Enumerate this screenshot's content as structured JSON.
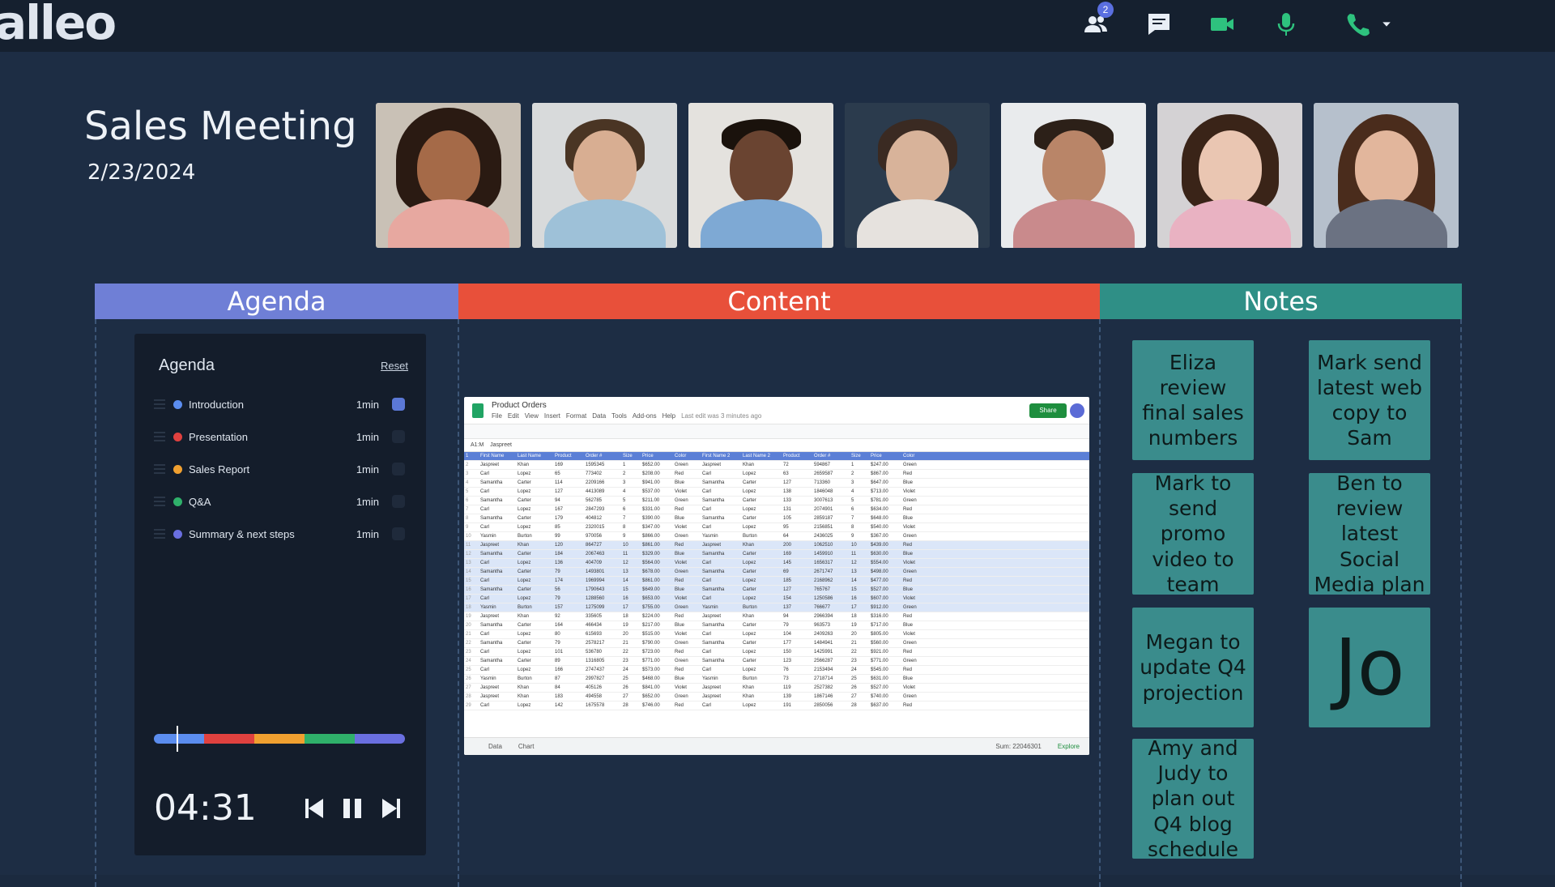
{
  "app": {
    "logo": "alleo"
  },
  "toolbar": {
    "participants_badge": "2",
    "icons": [
      "people-icon",
      "chat-icon",
      "video-camera-icon",
      "microphone-icon",
      "phone-icon",
      "chevron-down-icon"
    ],
    "colors": {
      "video": "#2ec27e",
      "mic": "#2ec27e",
      "phone": "#2ec27e"
    }
  },
  "meeting": {
    "title": "Sales Meeting",
    "date": "2/23/2024"
  },
  "participants_count": 7,
  "sections": {
    "agenda": "Agenda",
    "content": "Content",
    "notes": "Notes"
  },
  "section_colors": {
    "agenda": "#6f7fd6",
    "content": "#e8503a",
    "notes": "#2f8f86"
  },
  "agenda": {
    "title": "Agenda",
    "reset_label": "Reset",
    "items": [
      {
        "label": "Introduction",
        "time": "1min",
        "color": "#5b8def",
        "checked": true
      },
      {
        "label": "Presentation",
        "time": "1min",
        "color": "#e0413f",
        "checked": false
      },
      {
        "label": "Sales Report",
        "time": "1min",
        "color": "#f0a030",
        "checked": false
      },
      {
        "label": "Q&A",
        "time": "1min",
        "color": "#2fb06a",
        "checked": false
      },
      {
        "label": "Summary & next steps",
        "time": "1min",
        "color": "#6a6fe0",
        "checked": false
      }
    ],
    "timer": "04:31",
    "progress_colors": [
      "#5b8def",
      "#e0413f",
      "#f0a030",
      "#2fb06a",
      "#6a6fe0"
    ]
  },
  "spreadsheet": {
    "title": "Product Orders",
    "menu": [
      "File",
      "Edit",
      "View",
      "Insert",
      "Format",
      "Data",
      "Tools",
      "Add-ons",
      "Help"
    ],
    "last_edit": "Last edit was 3 minutes ago",
    "share_label": "Share",
    "cell_ref": "A1:M",
    "formula": "Jaspreet",
    "headers": [
      "First Name",
      "Last Name",
      "Product",
      "Order #",
      "Size",
      "Price",
      "Color",
      "First Name 2",
      "Last Name 2",
      "Product",
      "Order #",
      "Size",
      "Price",
      "Color"
    ],
    "rows": [
      [
        "Jaspreet",
        "Khan",
        "169",
        "1595345",
        "1",
        "$652.00",
        "Green",
        "Jaspreet",
        "Khan",
        "72",
        "594867",
        "1",
        "$247.00",
        "Green"
      ],
      [
        "Carl",
        "Lopez",
        "65",
        "773402",
        "2",
        "$208.00",
        "Red",
        "Carl",
        "Lopez",
        "63",
        "2659587",
        "2",
        "$867.00",
        "Red"
      ],
      [
        "Samantha",
        "Carter",
        "114",
        "2209166",
        "3",
        "$941.00",
        "Blue",
        "Samantha",
        "Carter",
        "127",
        "713360",
        "3",
        "$647.00",
        "Blue"
      ],
      [
        "Carl",
        "Lopez",
        "127",
        "4413089",
        "4",
        "$537.00",
        "Violet",
        "Carl",
        "Lopez",
        "138",
        "1846048",
        "4",
        "$713.00",
        "Violet"
      ],
      [
        "Samantha",
        "Carter",
        "94",
        "562785",
        "5",
        "$211.00",
        "Green",
        "Samantha",
        "Carter",
        "133",
        "3007613",
        "5",
        "$781.00",
        "Green"
      ],
      [
        "Carl",
        "Lopez",
        "167",
        "2847293",
        "6",
        "$331.00",
        "Red",
        "Carl",
        "Lopez",
        "131",
        "2074901",
        "6",
        "$634.00",
        "Red"
      ],
      [
        "Samantha",
        "Carter",
        "179",
        "404812",
        "7",
        "$390.00",
        "Blue",
        "Samantha",
        "Carter",
        "105",
        "2859187",
        "7",
        "$648.00",
        "Blue"
      ],
      [
        "Carl",
        "Lopez",
        "85",
        "2320015",
        "8",
        "$347.00",
        "Violet",
        "Carl",
        "Lopez",
        "95",
        "2156851",
        "8",
        "$540.00",
        "Violet"
      ],
      [
        "Yasmin",
        "Burton",
        "99",
        "970056",
        "9",
        "$866.00",
        "Green",
        "Yasmin",
        "Burton",
        "64",
        "2436025",
        "9",
        "$367.00",
        "Green"
      ],
      [
        "Jaspreet",
        "Khan",
        "120",
        "864727",
        "10",
        "$861.00",
        "Red",
        "Jaspreet",
        "Khan",
        "200",
        "1062510",
        "10",
        "$439.00",
        "Red"
      ],
      [
        "Samantha",
        "Carter",
        "184",
        "2067463",
        "11",
        "$329.00",
        "Blue",
        "Samantha",
        "Carter",
        "169",
        "1459910",
        "11",
        "$630.00",
        "Blue"
      ],
      [
        "Carl",
        "Lopez",
        "136",
        "404709",
        "12",
        "$564.00",
        "Violet",
        "Carl",
        "Lopez",
        "145",
        "1656317",
        "12",
        "$554.00",
        "Violet"
      ],
      [
        "Samantha",
        "Carter",
        "79",
        "1493801",
        "13",
        "$678.00",
        "Green",
        "Samantha",
        "Carter",
        "69",
        "2671747",
        "13",
        "$498.00",
        "Green"
      ],
      [
        "Carl",
        "Lopez",
        "174",
        "1969994",
        "14",
        "$861.00",
        "Red",
        "Carl",
        "Lopez",
        "185",
        "2168962",
        "14",
        "$477.00",
        "Red"
      ],
      [
        "Samantha",
        "Carter",
        "56",
        "1790643",
        "15",
        "$649.00",
        "Blue",
        "Samantha",
        "Carter",
        "127",
        "765767",
        "15",
        "$527.00",
        "Blue"
      ],
      [
        "Carl",
        "Lopez",
        "79",
        "1288560",
        "16",
        "$653.00",
        "Violet",
        "Carl",
        "Lopez",
        "154",
        "1250586",
        "16",
        "$607.00",
        "Violet"
      ],
      [
        "Yasmin",
        "Burton",
        "157",
        "1275099",
        "17",
        "$755.00",
        "Green",
        "Yasmin",
        "Burton",
        "137",
        "766677",
        "17",
        "$912.00",
        "Green"
      ],
      [
        "Jaspreet",
        "Khan",
        "92",
        "335605",
        "18",
        "$224.00",
        "Red",
        "Jaspreet",
        "Khan",
        "94",
        "2966394",
        "18",
        "$316.00",
        "Red"
      ],
      [
        "Samantha",
        "Carter",
        "164",
        "466434",
        "19",
        "$217.00",
        "Blue",
        "Samantha",
        "Carter",
        "79",
        "963573",
        "19",
        "$717.00",
        "Blue"
      ],
      [
        "Carl",
        "Lopez",
        "80",
        "615693",
        "20",
        "$515.00",
        "Violet",
        "Carl",
        "Lopez",
        "104",
        "2409263",
        "20",
        "$805.00",
        "Violet"
      ],
      [
        "Samantha",
        "Carter",
        "79",
        "2578217",
        "21",
        "$790.00",
        "Green",
        "Samantha",
        "Carter",
        "177",
        "1484941",
        "21",
        "$560.00",
        "Green"
      ],
      [
        "Carl",
        "Lopez",
        "101",
        "536780",
        "22",
        "$723.00",
        "Red",
        "Carl",
        "Lopez",
        "150",
        "1425991",
        "22",
        "$921.00",
        "Red"
      ],
      [
        "Samantha",
        "Carter",
        "89",
        "1316805",
        "23",
        "$771.00",
        "Green",
        "Samantha",
        "Carter",
        "123",
        "2566287",
        "23",
        "$771.00",
        "Green"
      ],
      [
        "Carl",
        "Lopez",
        "166",
        "2747437",
        "24",
        "$573.00",
        "Red",
        "Carl",
        "Lopez",
        "76",
        "2153494",
        "24",
        "$545.00",
        "Red"
      ],
      [
        "Yasmin",
        "Burton",
        "87",
        "2997827",
        "25",
        "$468.00",
        "Blue",
        "Yasmin",
        "Burton",
        "73",
        "2718714",
        "25",
        "$631.00",
        "Blue"
      ],
      [
        "Jaspreet",
        "Khan",
        "84",
        "405126",
        "26",
        "$841.00",
        "Violet",
        "Jaspreet",
        "Khan",
        "119",
        "2527382",
        "26",
        "$527.00",
        "Violet"
      ],
      [
        "Jaspreet",
        "Khan",
        "183",
        "494558",
        "27",
        "$652.00",
        "Green",
        "Jaspreet",
        "Khan",
        "139",
        "1867146",
        "27",
        "$740.00",
        "Green"
      ],
      [
        "Carl",
        "Lopez",
        "142",
        "1675578",
        "28",
        "$746.00",
        "Red",
        "Carl",
        "Lopez",
        "191",
        "2850056",
        "28",
        "$637.00",
        "Red"
      ]
    ],
    "selected_rows": [
      9,
      10,
      11,
      12,
      13,
      14,
      15,
      16
    ],
    "sheet_tabs": [
      "Data",
      "Chart"
    ],
    "sum_label": "Sum: 22046301",
    "explore_label": "Explore"
  },
  "notes": [
    {
      "text": "Eliza review final sales numbers"
    },
    {
      "text": "Mark send latest web copy to Sam"
    },
    {
      "text": "Mark to send promo video to team"
    },
    {
      "text": "Ben to review latest Social Media plan"
    },
    {
      "text": "Megan to update Q4 projection"
    },
    {
      "text": "Jo"
    },
    {
      "text": "Amy and Judy to plan out Q4 blog schedule"
    }
  ],
  "note_color": "#3a8c8c"
}
